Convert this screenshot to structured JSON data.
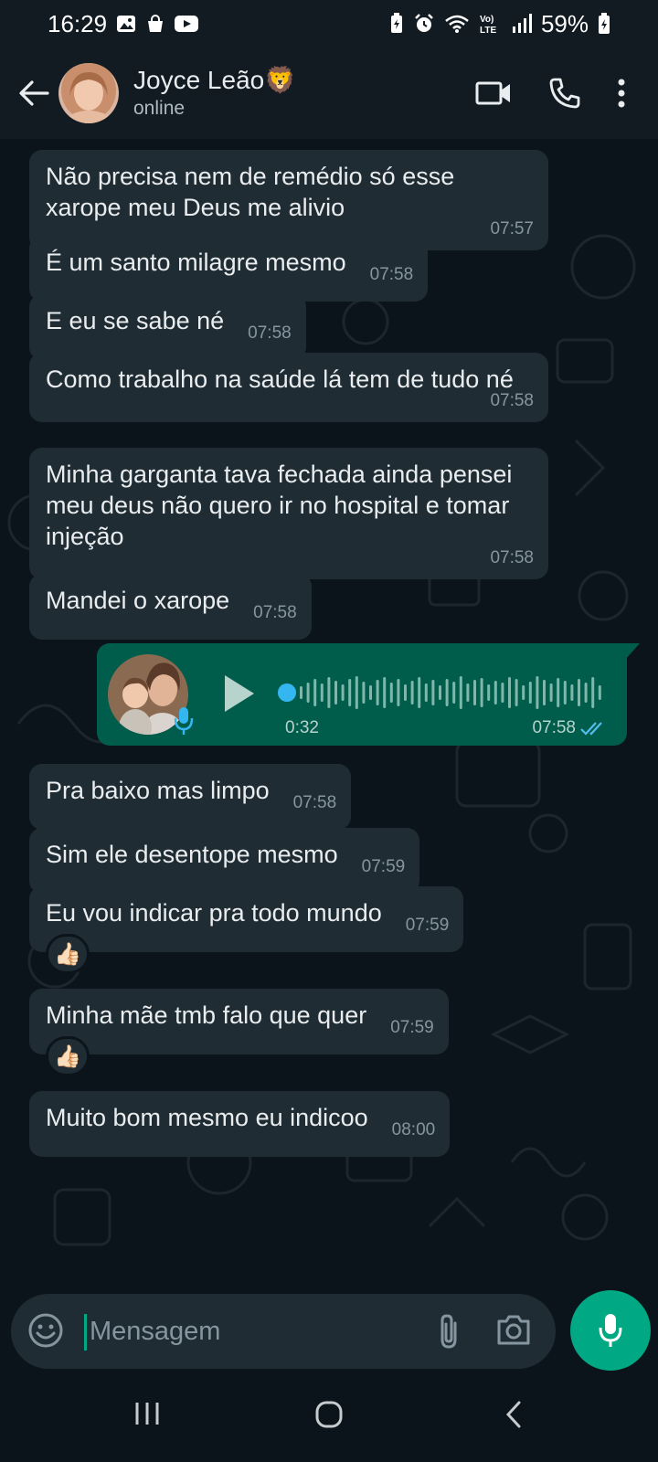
{
  "status_bar": {
    "time": "16:29",
    "battery": "59%",
    "left_icons": [
      "gallery-icon",
      "shopping-bag-icon",
      "youtube-icon"
    ],
    "right_icons": [
      "battery-saver-icon",
      "alarm-icon",
      "wifi-icon",
      "volte-icon",
      "signal-icon",
      "battery-icon"
    ]
  },
  "header": {
    "contact_name": "Joyce Leão🦁",
    "contact_status": "online",
    "actions": [
      "video-call-icon",
      "phone-icon",
      "more-vert-icon"
    ]
  },
  "messages": [
    {
      "text": "Não precisa nem de remédio só esse xarope meu Deus me alivio",
      "time": "07:57"
    },
    {
      "text": "É um santo milagre mesmo",
      "time": "07:58"
    },
    {
      "text": "E eu se sabe né",
      "time": "07:58"
    },
    {
      "text": "Como trabalho na saúde lá tem de tudo né",
      "time": "07:58"
    },
    {
      "text": "Minha garganta tava fechada ainda pensei meu deus não quero ir no hospital e tomar injeção",
      "time": "07:58"
    },
    {
      "text": "Mandei o xarope",
      "time": "07:58"
    },
    {
      "text": "Pra baixo mas limpo",
      "time": "07:58"
    },
    {
      "text": "Sim ele desentope mesmo",
      "time": "07:59"
    },
    {
      "text": "Eu vou indicar pra todo mundo",
      "time": "07:59",
      "reaction": "👍🏻"
    },
    {
      "text": "Minha mãe tmb falo que quer",
      "time": "07:59",
      "reaction": "👍🏻"
    },
    {
      "text": "Muito bom mesmo eu indicoo",
      "time": "08:00"
    }
  ],
  "voice_message": {
    "duration": "0:32",
    "time": "07:58",
    "status": "read",
    "playback_progress": 0,
    "colors": {
      "bubble": "#005c4b",
      "ticks": "#53bdeb",
      "dot": "#34b7f1"
    }
  },
  "composer": {
    "placeholder": "Mensagem"
  },
  "theme": {
    "accent": "#00a884",
    "incoming_bubble": "#202c33",
    "background": "#0b141a"
  }
}
